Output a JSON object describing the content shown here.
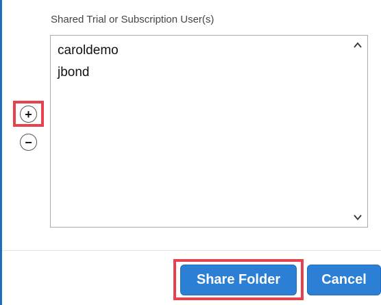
{
  "share_panel": {
    "field_label": "Shared Trial or Subscription User(s)",
    "users": [
      "caroldemo",
      "jbond"
    ],
    "add_symbol": "+",
    "remove_symbol": "−"
  },
  "footer": {
    "share_label": "Share Folder",
    "cancel_label": "Cancel"
  },
  "colors": {
    "primary": "#2b7fd4",
    "highlight": "#e8414e",
    "left_border": "#1d6fb8"
  },
  "icons": {
    "scroll_up": "chevron-up-icon",
    "scroll_down": "chevron-down-icon"
  }
}
